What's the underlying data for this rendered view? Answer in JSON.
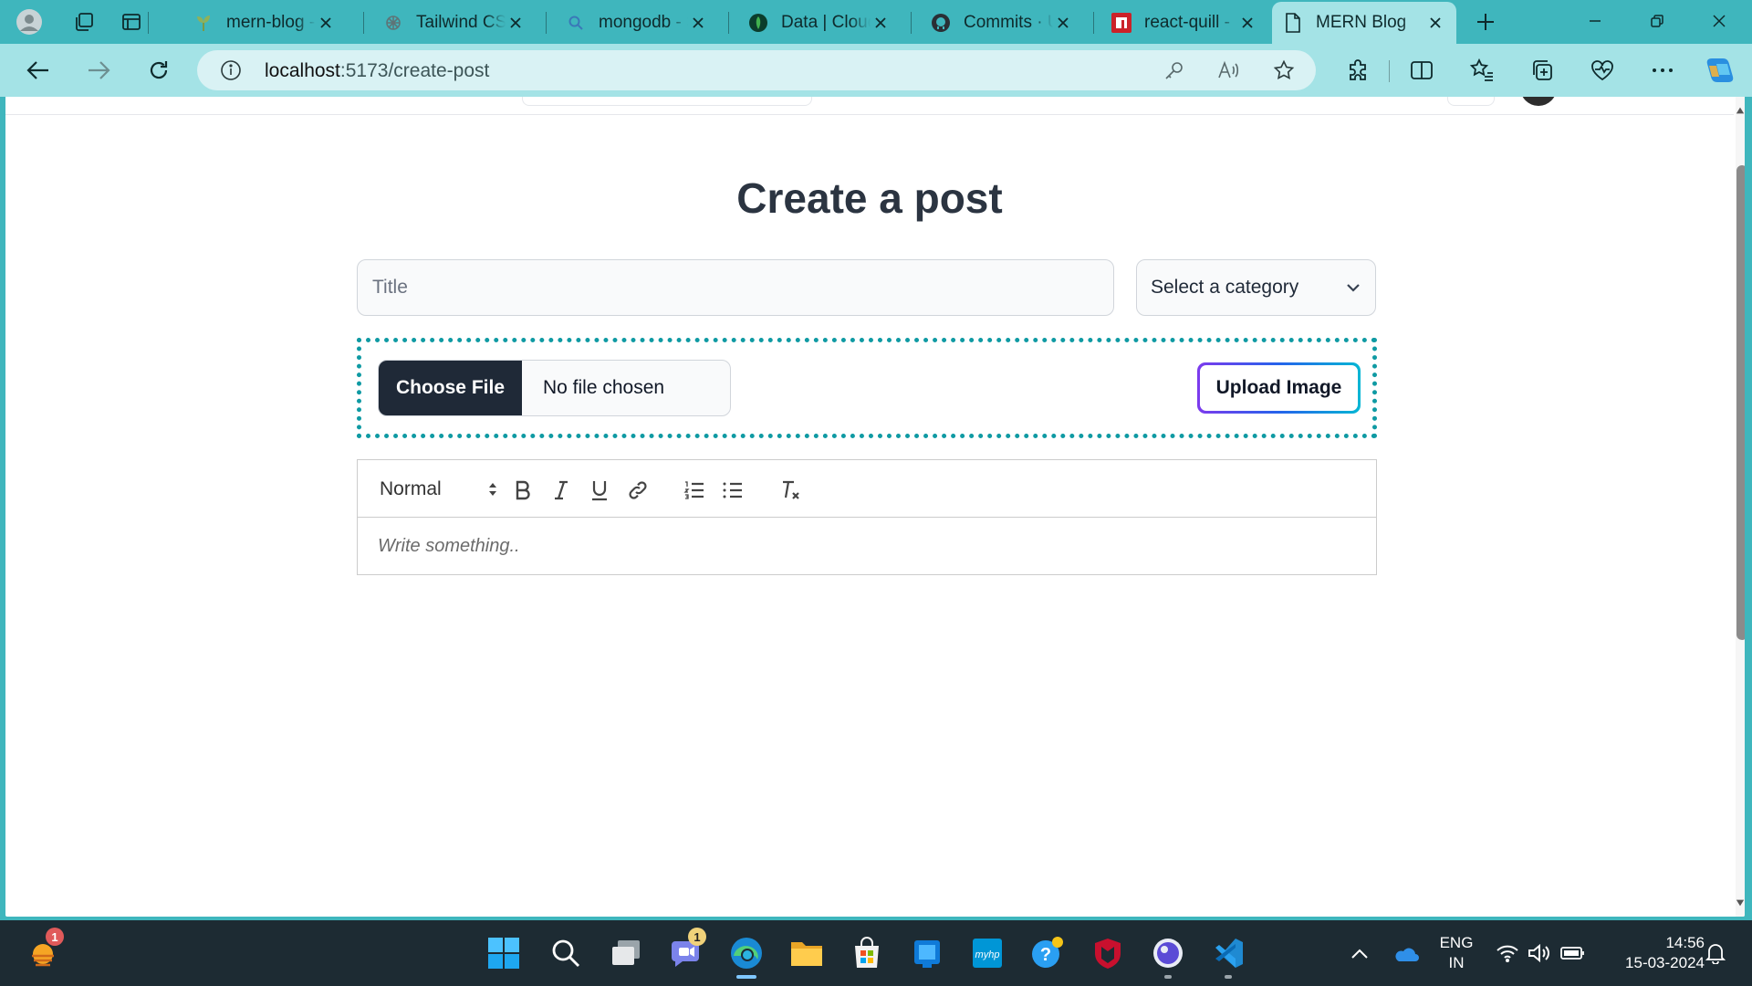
{
  "browser": {
    "tabs": [
      {
        "label": "mern-blog - ",
        "favicon": "sprout-favicon-icon"
      },
      {
        "label": "Tailwind CSS",
        "favicon": "openai-favicon-icon"
      },
      {
        "label": "mongodb - S",
        "favicon": "search-favicon-icon"
      },
      {
        "label": "Data | Cloud",
        "favicon": "mongodb-leaf-favicon-icon"
      },
      {
        "label": "Commits · U",
        "favicon": "github-favicon-icon"
      },
      {
        "label": "react-quill - ",
        "favicon": "npm-favicon-icon"
      },
      {
        "label": "MERN Blog",
        "favicon": "page-favicon-icon",
        "active": true
      }
    ],
    "address": {
      "host": "localhost",
      "path": ":5173/create-post"
    }
  },
  "page": {
    "heading": "Create a post",
    "title_placeholder": "Title",
    "category_selected": "Select a category",
    "file_button": "Choose File",
    "file_status": "No file chosen",
    "upload_button": "Upload Image",
    "editor": {
      "heading_format": "Normal",
      "placeholder": "Write something.."
    }
  },
  "taskbar": {
    "weather_badge": "1",
    "teams_badge": "1",
    "language_line1": "ENG",
    "language_line2": "IN",
    "time": "14:56",
    "date": "15-03-2024",
    "hp_label": "myhp"
  },
  "colors": {
    "theme_teal": "#3fb6bd",
    "toolbar_teal": "#a4e3e6",
    "upload_border": "#0f9aa3",
    "dark_button": "#1f2937",
    "gradient": [
      "#7c3aed",
      "#2563eb",
      "#06b6d4"
    ]
  }
}
